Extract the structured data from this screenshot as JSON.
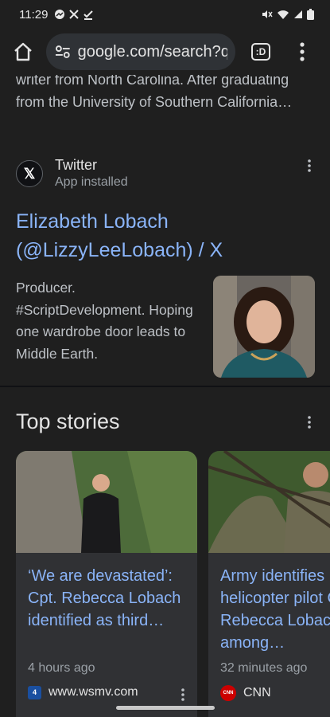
{
  "status_bar": {
    "time": "11:29",
    "left_icons": [
      "messenger-icon",
      "x-icon",
      "download-done-icon"
    ],
    "right_icons": [
      "mute-icon",
      "wifi-icon",
      "signal-icon",
      "battery-icon"
    ]
  },
  "toolbar": {
    "url": "google.com/search?q",
    "tab_count": ":D"
  },
  "previous_result": {
    "line1": "writer from North Carolina. After graduating",
    "line2": "from the University of Southern California…"
  },
  "twitter_result": {
    "source_name": "Twitter",
    "source_sub": "App installed",
    "title": "Elizabeth Lobach (@LizzyLeeLobach) / X",
    "snippet": "Producer. #ScriptDevelopment. Hoping one wardrobe door leads to Middle Earth."
  },
  "top_stories": {
    "heading": "Top stories",
    "stories": [
      {
        "title": "‘We are devastated’: Cpt. Rebecca Lobach identified as third…",
        "time": "4 hours ago",
        "source": "www.wsmv.com",
        "source_logo": "4"
      },
      {
        "title": "Army identifies helicopter pilot Capt. Rebecca Lobach among…",
        "time": "32 minutes ago",
        "source": "CNN",
        "source_logo": "CNN"
      }
    ]
  },
  "colors": {
    "link": "#8ab4f8",
    "background": "#1f1f1f",
    "separator": "#101114"
  }
}
